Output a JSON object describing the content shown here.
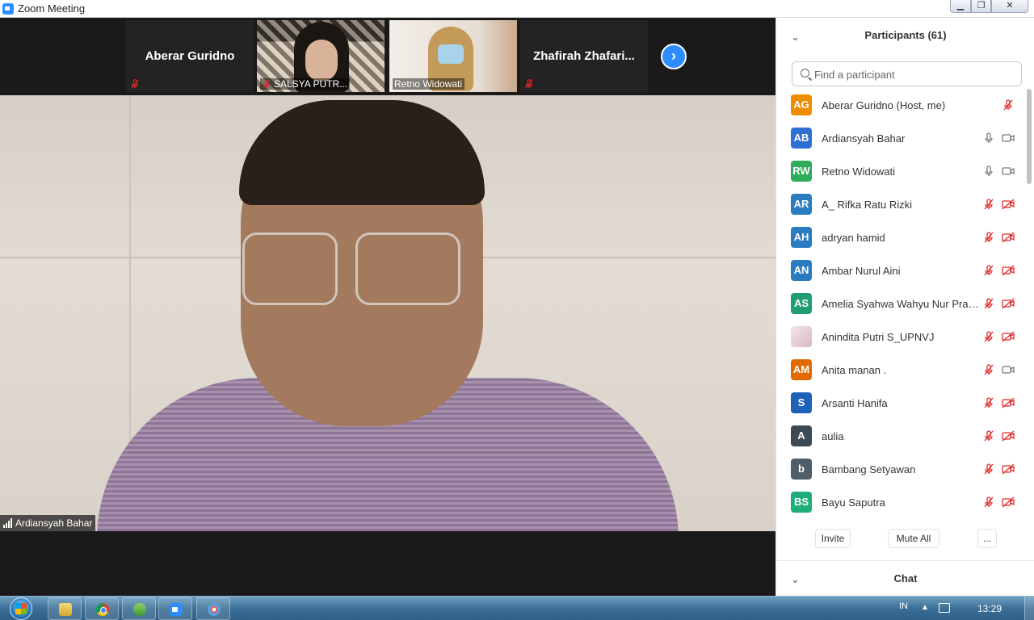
{
  "window": {
    "title": "Zoom Meeting",
    "controls": [
      "minimize",
      "maximize",
      "close"
    ]
  },
  "thumbnails": [
    {
      "name": "Aberar Guridno",
      "type": "name-tile",
      "muted": true
    },
    {
      "name": "SALSYA PUTR...",
      "type": "video",
      "muted": true
    },
    {
      "name": "Retno Widowati",
      "type": "video",
      "muted": false
    },
    {
      "name": "Zhafirah  Zhafari...",
      "type": "name-tile",
      "muted": true
    }
  ],
  "next_arrow_icon": "chevron-right-icon",
  "main_video": {
    "speaker_name": "Ardiansyah Bahar"
  },
  "participants_panel": {
    "title": "Participants (61)",
    "search_placeholder": "Find a participant",
    "participants": [
      {
        "initials": "AG",
        "name": "Aberar Guridno (Host, me)",
        "color": "#f08c00",
        "mic": "muted",
        "video": "none"
      },
      {
        "initials": "AB",
        "name": "Ardiansyah Bahar",
        "color": "#2e6fd3",
        "mic": "on",
        "video": "on"
      },
      {
        "initials": "RW",
        "name": "Retno Widowati",
        "color": "#2eac59",
        "mic": "on",
        "video": "on"
      },
      {
        "initials": "AR",
        "name": "A_ Rifka Ratu Rizki",
        "color": "#2a7bc0",
        "mic": "muted",
        "video": "off"
      },
      {
        "initials": "AH",
        "name": "adryan hamid",
        "color": "#2a7bc0",
        "mic": "muted",
        "video": "off"
      },
      {
        "initials": "AN",
        "name": "Ambar Nurul Aini",
        "color": "#2a7bc0",
        "mic": "muted",
        "video": "off"
      },
      {
        "initials": "AS",
        "name": "Amelia Syahwa Wahyu Nur Prati...",
        "color": "#1f9e74",
        "mic": "muted",
        "video": "off"
      },
      {
        "initials": "",
        "name": "Anindita Putri S_UPNVJ",
        "color": "photo",
        "mic": "muted",
        "video": "off"
      },
      {
        "initials": "AM",
        "name": "Anita manan .",
        "color": "#e06a00",
        "mic": "muted",
        "video": "on"
      },
      {
        "initials": "S",
        "name": "Arsanti Hanifa",
        "color": "#1e62b8",
        "mic": "muted",
        "video": "off"
      },
      {
        "initials": "A",
        "name": "aulia",
        "color": "#3d4a55",
        "mic": "muted",
        "video": "off"
      },
      {
        "initials": "b",
        "name": "Bambang Setyawan",
        "color": "#4f5d68",
        "mic": "muted",
        "video": "off"
      },
      {
        "initials": "BS",
        "name": "Bayu Saputra",
        "color": "#1fae77",
        "mic": "muted",
        "video": "off"
      }
    ],
    "actions": {
      "invite": "Invite",
      "mute_all": "Mute All",
      "more": "..."
    }
  },
  "chat_panel": {
    "title": "Chat"
  },
  "taskbar": {
    "apps": [
      "start-button",
      "explorer",
      "chrome",
      "messenger",
      "zoom",
      "paint"
    ],
    "language": "IN",
    "clock": "13:29"
  },
  "colors": {
    "zoom_blue": "#2d8cff",
    "muted_red": "#e02828",
    "panel_bg": "#ffffff",
    "video_bg": "#1a1a1a"
  }
}
